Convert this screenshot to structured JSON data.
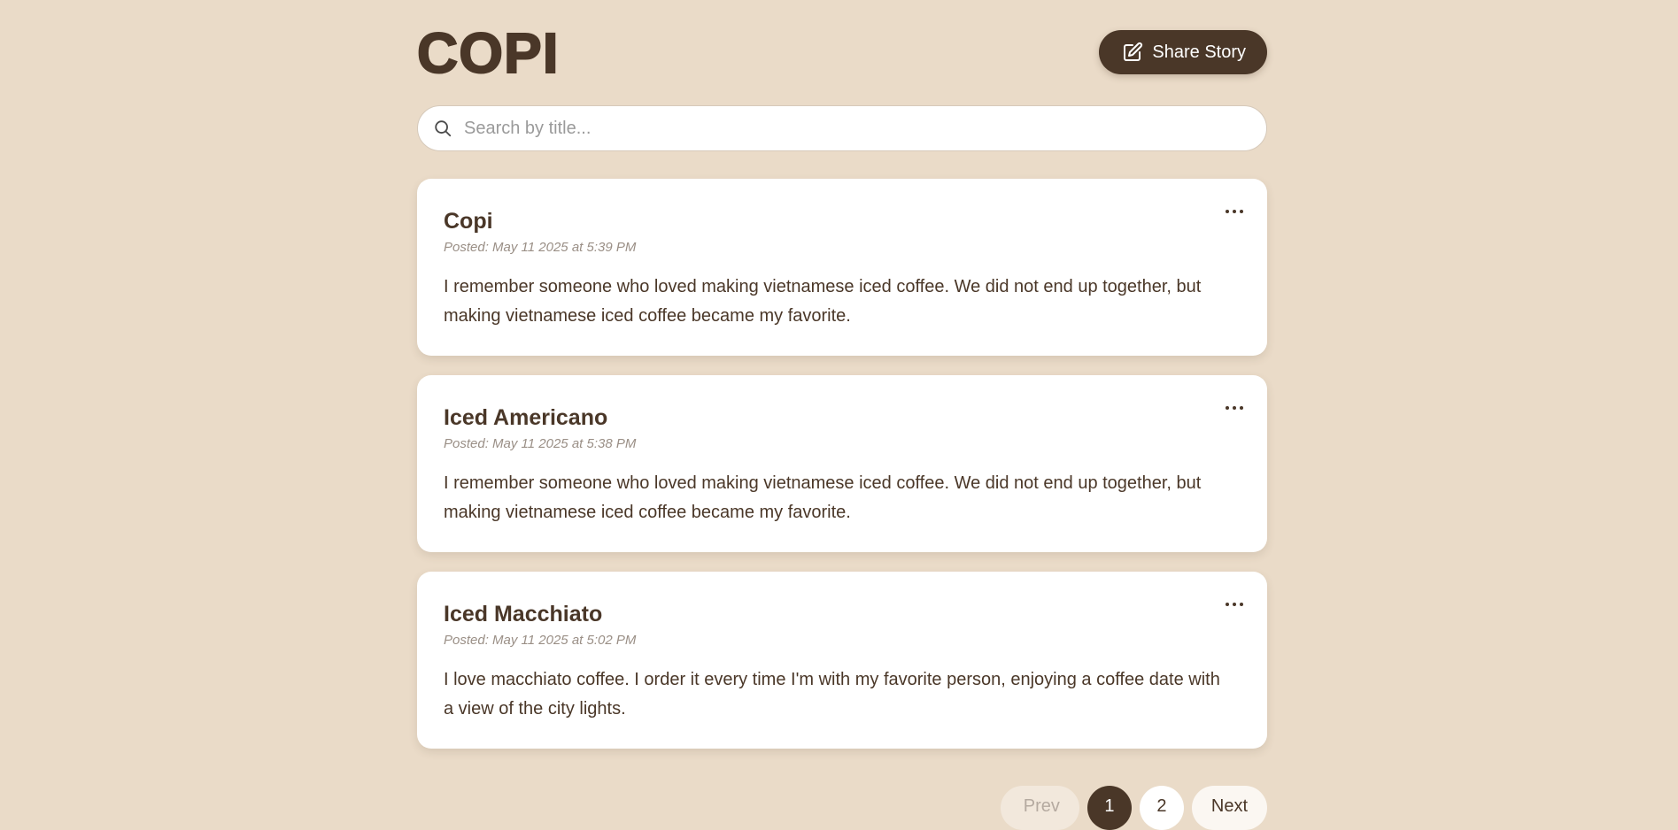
{
  "header": {
    "logo": "COPI",
    "share_button": "Share Story",
    "share_icon": "edit-pencil-icon"
  },
  "search": {
    "placeholder": "Search by title...",
    "value": "",
    "icon": "search-icon"
  },
  "posts": [
    {
      "title": "Copi",
      "meta": "Posted: May 11 2025 at 5:39 PM",
      "body": "I remember someone who loved making vietnamese iced coffee. We did not end up together, but making vietnamese iced coffee became my favorite."
    },
    {
      "title": "Iced Americano",
      "meta": "Posted: May 11 2025 at 5:38 PM",
      "body": "I remember someone who loved making vietnamese iced coffee. We did not end up together, but making vietnamese iced coffee became my favorite."
    },
    {
      "title": "Iced Macchiato",
      "meta": "Posted: May 11 2025 at 5:02 PM",
      "body": "I love macchiato coffee. I order it every time I'm with my favorite person, enjoying a coffee date with a view of the city lights."
    }
  ],
  "pagination": {
    "prev": "Prev",
    "pages": [
      "1",
      "2"
    ],
    "current": "1",
    "next": "Next"
  },
  "colors": {
    "background": "#EADBC8",
    "primary": "#4A3728",
    "card": "#FFFFFF"
  }
}
